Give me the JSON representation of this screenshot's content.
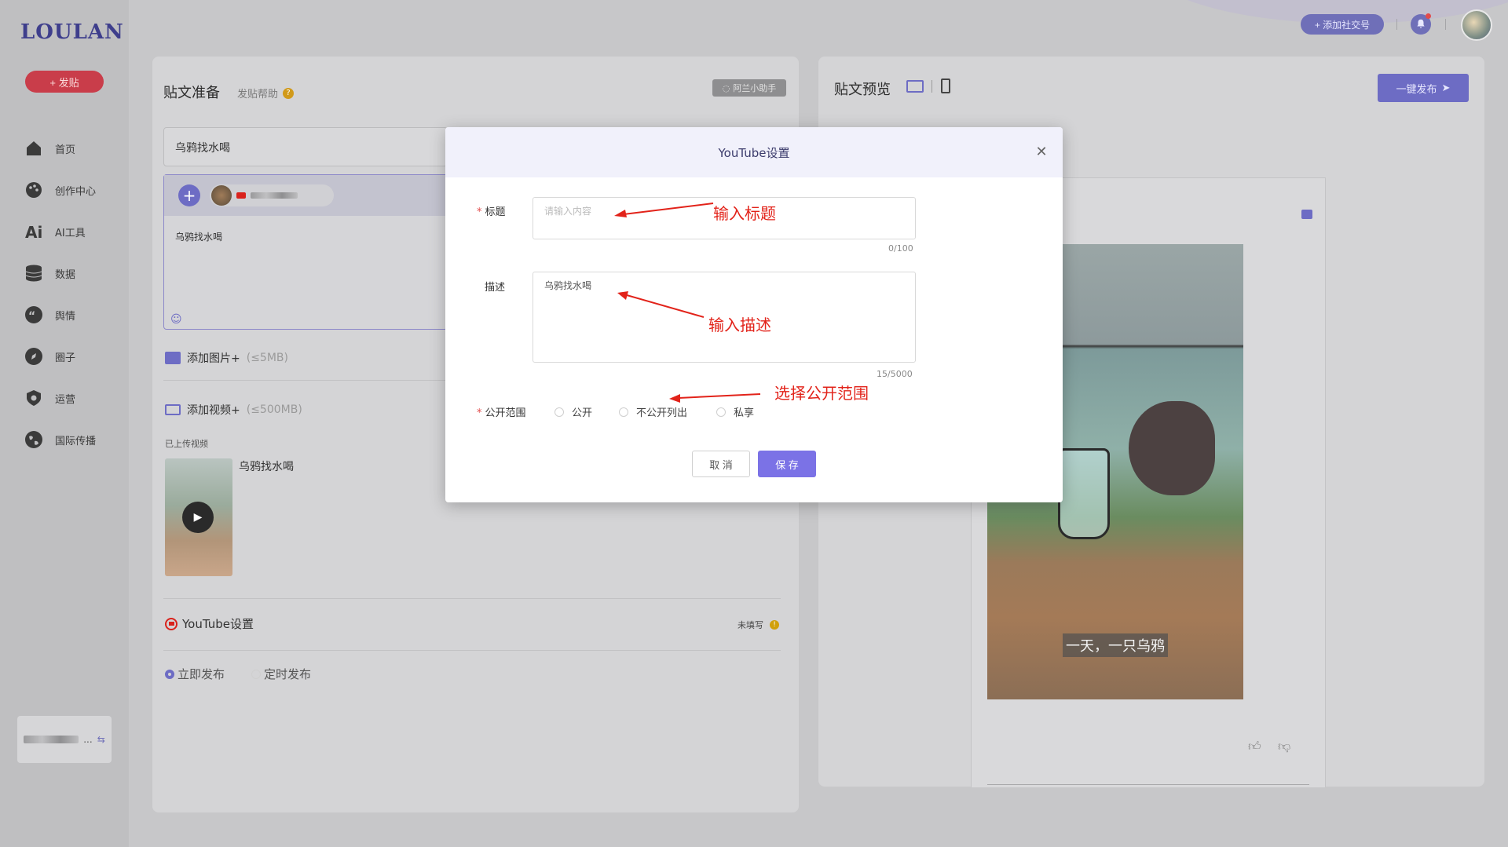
{
  "sidebar": {
    "logo": "LOULAN",
    "post_button": "+ 发贴",
    "items": [
      {
        "label": "首页",
        "icon": "home-icon"
      },
      {
        "label": "创作中心",
        "icon": "palette-icon"
      },
      {
        "label": "AI工具",
        "icon": "ai-icon"
      },
      {
        "label": "数据",
        "icon": "database-icon"
      },
      {
        "label": "舆情",
        "icon": "quote-icon"
      },
      {
        "label": "圈子",
        "icon": "compass-icon"
      },
      {
        "label": "运营",
        "icon": "gear-shield-icon"
      },
      {
        "label": "国际传播",
        "icon": "globe-icon"
      }
    ],
    "account_suffix": "..."
  },
  "topbar": {
    "add_social": "+ 添加社交号"
  },
  "compose": {
    "title": "贴文准备",
    "help": "发贴帮助",
    "assistant": "阿兰小助手",
    "title_value": "乌鸦找水喝",
    "body_value": "乌鸦找水喝",
    "add_image": "添加图片+",
    "add_image_limit": "(≤5MB)",
    "add_video": "添加视频+",
    "add_video_limit": "(≤500MB)",
    "uploaded_label": "已上传视频",
    "video_name": "乌鸦找水喝",
    "youtube_settings": "YouTube设置",
    "not_filled": "未填写",
    "publish_now": "立即发布",
    "publish_scheduled": "定时发布"
  },
  "preview": {
    "title": "贴文预览",
    "one_click_publish": "一键发布",
    "subtitle_text": "一天，一只乌鸦"
  },
  "modal": {
    "title": "YouTube设置",
    "title_label": "标题",
    "title_placeholder": "请输入内容",
    "title_count": "0/100",
    "desc_label": "描述",
    "desc_value": "乌鸦找水喝",
    "desc_count": "15/5000",
    "visibility_label": "公开范围",
    "options": [
      "公开",
      "不公开列出",
      "私享"
    ],
    "cancel": "取 消",
    "save": "保 存"
  },
  "annotations": {
    "title_hint": "输入标题",
    "desc_hint": "输入描述",
    "visibility_hint": "选择公开范围"
  },
  "colors": {
    "accent": "#7b72e6",
    "danger": "#e2231a",
    "post_button": "#c93d4a"
  }
}
